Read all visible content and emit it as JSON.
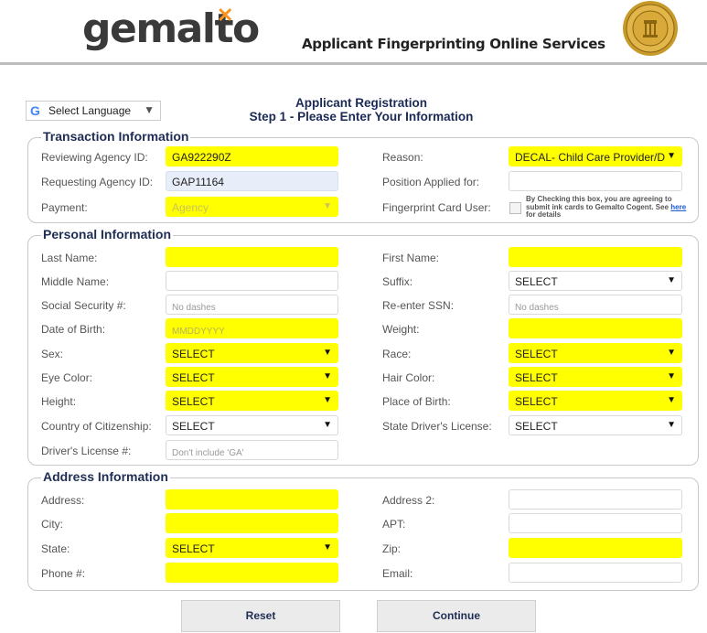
{
  "header": {
    "logo_text": "gemalto",
    "logo_mark": "✕",
    "subtitle": "Applicant Fingerprinting Online Services",
    "seal_icon": "georgia-state-seal-icon"
  },
  "language": {
    "label": "Select Language",
    "arrow": "▼",
    "g": "G"
  },
  "title": {
    "line1": "Applicant Registration",
    "line2": "Step 1 - Please Enter Your Information"
  },
  "transaction": {
    "legend": "Transaction Information",
    "reviewing_label": "Reviewing Agency ID:",
    "reviewing_value": "GA922290Z",
    "requesting_label": "Requesting Agency ID:",
    "requesting_value": "GAP11164",
    "payment_label": "Payment:",
    "payment_value": "Agency",
    "reason_label": "Reason:",
    "reason_value": "DECAL- Child Care Provider/D",
    "position_label": "Position Applied for:",
    "position_value": "",
    "fpcard_label": "Fingerprint Card User:",
    "fpcard_note_pre": "By Checking this box, you are agreeing to submit ink cards to Gemalto Cogent. See",
    "fpcard_note_link": "here",
    "fpcard_note_post": "for details"
  },
  "personal": {
    "legend": "Personal Information",
    "last_name_label": "Last Name:",
    "middle_name_label": "Middle Name:",
    "ssn_label": "Social Security #:",
    "ssn_placeholder": "No dashes",
    "dob_label": "Date of Birth:",
    "dob_placeholder": "MMDDYYYY",
    "sex_label": "Sex:",
    "eye_label": "Eye Color:",
    "height_label": "Height:",
    "citizenship_label": "Country of Citizenship:",
    "dl_label": "Driver's License #:",
    "dl_placeholder": "Don't include 'GA'",
    "first_name_label": "First Name:",
    "suffix_label": "Suffix:",
    "ssn2_label": "Re-enter SSN:",
    "ssn2_placeholder": "No dashes",
    "weight_label": "Weight:",
    "race_label": "Race:",
    "hair_label": "Hair Color:",
    "pob_label": "Place of Birth:",
    "state_dl_label": "State Driver's License:",
    "select_text": "SELECT"
  },
  "address": {
    "legend": "Address Information",
    "address_label": "Address:",
    "city_label": "City:",
    "state_label": "State:",
    "phone_label": "Phone #:",
    "address2_label": "Address 2:",
    "apt_label": "APT:",
    "zip_label": "Zip:",
    "email_label": "Email:",
    "select_text": "SELECT"
  },
  "buttons": {
    "reset": "Reset",
    "continue": "Continue"
  },
  "colors": {
    "required_yellow": "#ffff00",
    "prefilled_blue": "#e8eef9",
    "heading_navy": "#1f2d54",
    "logo_orange": "#f7931e"
  }
}
